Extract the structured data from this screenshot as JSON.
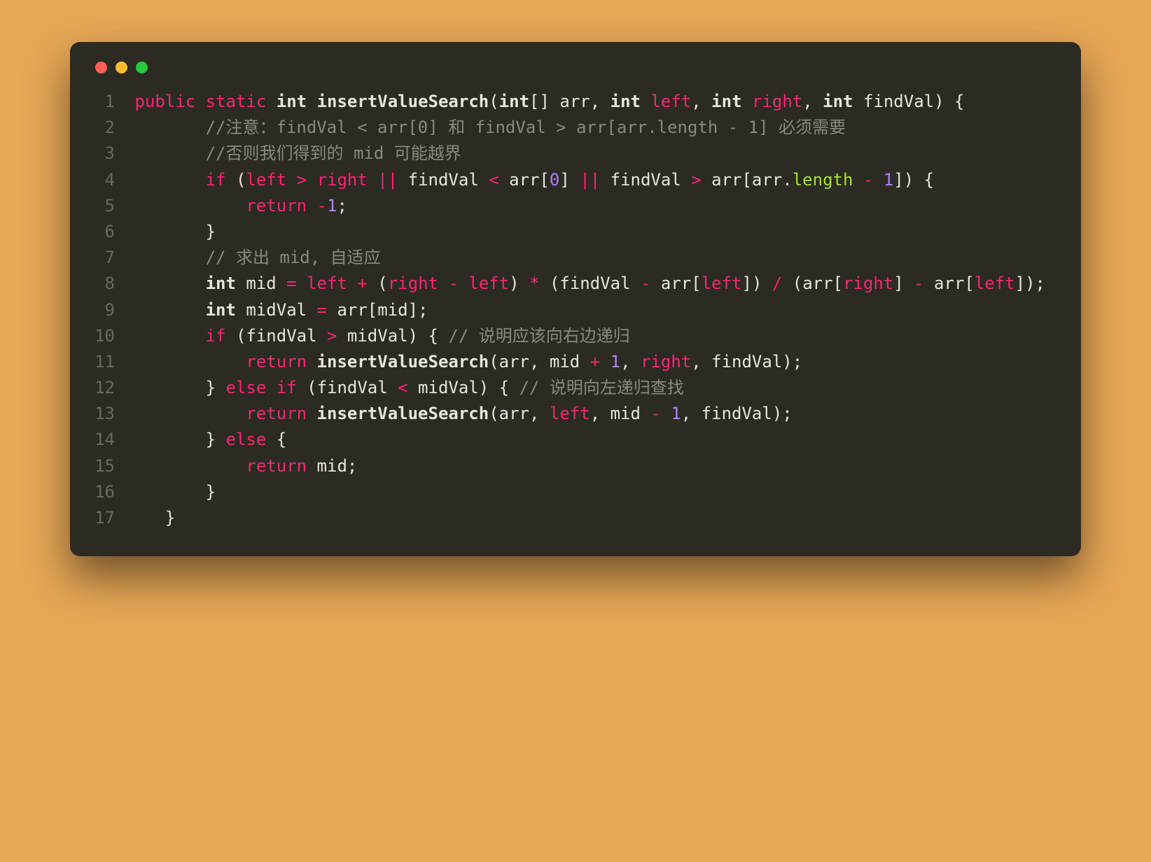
{
  "window": {
    "dots": [
      "red",
      "yellow",
      "green"
    ]
  },
  "code": {
    "lines": [
      {
        "n": "1",
        "tokens": [
          [
            "plain",
            " "
          ],
          [
            "kw",
            "public"
          ],
          [
            "plain",
            " "
          ],
          [
            "kw",
            "static"
          ],
          [
            "plain",
            " "
          ],
          [
            "type",
            "int"
          ],
          [
            "plain",
            " "
          ],
          [
            "fn",
            "insertValueSearch"
          ],
          [
            "pun",
            "("
          ],
          [
            "type",
            "int"
          ],
          [
            "pun",
            "[] "
          ],
          [
            "plain",
            "arr"
          ],
          [
            "pun",
            ", "
          ],
          [
            "type",
            "int"
          ],
          [
            "plain",
            " "
          ],
          [
            "var",
            "left"
          ],
          [
            "pun",
            ", "
          ],
          [
            "type",
            "int"
          ],
          [
            "plain",
            " "
          ],
          [
            "var",
            "right"
          ],
          [
            "pun",
            ", "
          ],
          [
            "type",
            "int"
          ],
          [
            "plain",
            " findVal"
          ],
          [
            "pun",
            ") {"
          ]
        ]
      },
      {
        "n": "2",
        "tokens": [
          [
            "plain",
            "        "
          ],
          [
            "com",
            "//注意：findVal < arr[0] 和 findVal > arr[arr.length - 1] 必须需要"
          ]
        ]
      },
      {
        "n": "3",
        "tokens": [
          [
            "plain",
            "        "
          ],
          [
            "com",
            "//否则我们得到的 mid 可能越界"
          ]
        ]
      },
      {
        "n": "4",
        "tokens": [
          [
            "plain",
            "        "
          ],
          [
            "kw",
            "if"
          ],
          [
            "plain",
            " "
          ],
          [
            "pun",
            "("
          ],
          [
            "var",
            "left"
          ],
          [
            "plain",
            " "
          ],
          [
            "op",
            ">"
          ],
          [
            "plain",
            " "
          ],
          [
            "var",
            "right"
          ],
          [
            "plain",
            " "
          ],
          [
            "op",
            "||"
          ],
          [
            "plain",
            " findVal "
          ],
          [
            "op",
            "<"
          ],
          [
            "plain",
            " arr["
          ],
          [
            "num",
            "0"
          ],
          [
            "plain",
            "] "
          ],
          [
            "op",
            "||"
          ],
          [
            "plain",
            " findVal "
          ],
          [
            "op",
            ">"
          ],
          [
            "plain",
            " arr[arr"
          ],
          [
            "pun",
            "."
          ],
          [
            "prop",
            "length"
          ],
          [
            "plain",
            " "
          ],
          [
            "op",
            "-"
          ],
          [
            "plain",
            " "
          ],
          [
            "num",
            "1"
          ],
          [
            "plain",
            "]"
          ],
          [
            "pun",
            ") {"
          ]
        ]
      },
      {
        "n": "5",
        "tokens": [
          [
            "plain",
            "            "
          ],
          [
            "kw",
            "return"
          ],
          [
            "plain",
            " "
          ],
          [
            "op",
            "-"
          ],
          [
            "num",
            "1"
          ],
          [
            "pun",
            ";"
          ]
        ]
      },
      {
        "n": "6",
        "tokens": [
          [
            "plain",
            "        "
          ],
          [
            "pun",
            "}"
          ]
        ]
      },
      {
        "n": "7",
        "tokens": [
          [
            "plain",
            "        "
          ],
          [
            "com",
            "// 求出 mid, 自适应"
          ]
        ]
      },
      {
        "n": "8",
        "tokens": [
          [
            "plain",
            "        "
          ],
          [
            "type",
            "int"
          ],
          [
            "plain",
            " mid "
          ],
          [
            "op",
            "="
          ],
          [
            "plain",
            " "
          ],
          [
            "var",
            "left"
          ],
          [
            "plain",
            " "
          ],
          [
            "op",
            "+"
          ],
          [
            "plain",
            " "
          ],
          [
            "pun",
            "("
          ],
          [
            "var",
            "right"
          ],
          [
            "plain",
            " "
          ],
          [
            "op",
            "-"
          ],
          [
            "plain",
            " "
          ],
          [
            "var",
            "left"
          ],
          [
            "pun",
            ")"
          ],
          [
            "plain",
            " "
          ],
          [
            "op",
            "*"
          ],
          [
            "plain",
            " "
          ],
          [
            "pun",
            "("
          ],
          [
            "plain",
            "findVal "
          ],
          [
            "op",
            "-"
          ],
          [
            "plain",
            " arr["
          ],
          [
            "var",
            "left"
          ],
          [
            "plain",
            "]"
          ],
          [
            "pun",
            ")"
          ],
          [
            "plain",
            " "
          ],
          [
            "op",
            "/"
          ],
          [
            "plain",
            " "
          ],
          [
            "pun",
            "("
          ],
          [
            "plain",
            "arr["
          ],
          [
            "var",
            "right"
          ],
          [
            "plain",
            "] "
          ],
          [
            "op",
            "-"
          ],
          [
            "plain",
            " arr["
          ],
          [
            "var",
            "left"
          ],
          [
            "plain",
            "]"
          ],
          [
            "pun",
            ");"
          ]
        ]
      },
      {
        "n": "9",
        "tokens": [
          [
            "plain",
            "        "
          ],
          [
            "type",
            "int"
          ],
          [
            "plain",
            " midVal "
          ],
          [
            "op",
            "="
          ],
          [
            "plain",
            " arr[mid]"
          ],
          [
            "pun",
            ";"
          ]
        ]
      },
      {
        "n": "10",
        "tokens": [
          [
            "plain",
            "        "
          ],
          [
            "kw",
            "if"
          ],
          [
            "plain",
            " "
          ],
          [
            "pun",
            "("
          ],
          [
            "plain",
            "findVal "
          ],
          [
            "op",
            ">"
          ],
          [
            "plain",
            " midVal"
          ],
          [
            "pun",
            ") { "
          ],
          [
            "com",
            "// 说明应该向右边递归"
          ]
        ]
      },
      {
        "n": "11",
        "tokens": [
          [
            "plain",
            "            "
          ],
          [
            "kw",
            "return"
          ],
          [
            "plain",
            " "
          ],
          [
            "fn",
            "insertValueSearch"
          ],
          [
            "pun",
            "("
          ],
          [
            "plain",
            "arr"
          ],
          [
            "pun",
            ", "
          ],
          [
            "plain",
            "mid "
          ],
          [
            "op",
            "+"
          ],
          [
            "plain",
            " "
          ],
          [
            "num",
            "1"
          ],
          [
            "pun",
            ", "
          ],
          [
            "var",
            "right"
          ],
          [
            "pun",
            ", "
          ],
          [
            "plain",
            "findVal"
          ],
          [
            "pun",
            ");"
          ]
        ]
      },
      {
        "n": "12",
        "tokens": [
          [
            "plain",
            "        "
          ],
          [
            "pun",
            "} "
          ],
          [
            "kw",
            "else"
          ],
          [
            "plain",
            " "
          ],
          [
            "kw",
            "if"
          ],
          [
            "plain",
            " "
          ],
          [
            "pun",
            "("
          ],
          [
            "plain",
            "findVal "
          ],
          [
            "op",
            "<"
          ],
          [
            "plain",
            " midVal"
          ],
          [
            "pun",
            ") { "
          ],
          [
            "com",
            "// 说明向左递归查找"
          ]
        ]
      },
      {
        "n": "13",
        "tokens": [
          [
            "plain",
            "            "
          ],
          [
            "kw",
            "return"
          ],
          [
            "plain",
            " "
          ],
          [
            "fn",
            "insertValueSearch"
          ],
          [
            "pun",
            "("
          ],
          [
            "plain",
            "arr"
          ],
          [
            "pun",
            ", "
          ],
          [
            "var",
            "left"
          ],
          [
            "pun",
            ", "
          ],
          [
            "plain",
            "mid "
          ],
          [
            "op",
            "-"
          ],
          [
            "plain",
            " "
          ],
          [
            "num",
            "1"
          ],
          [
            "pun",
            ", "
          ],
          [
            "plain",
            "findVal"
          ],
          [
            "pun",
            ");"
          ]
        ]
      },
      {
        "n": "14",
        "tokens": [
          [
            "plain",
            "        "
          ],
          [
            "pun",
            "} "
          ],
          [
            "kw",
            "else"
          ],
          [
            "plain",
            " "
          ],
          [
            "pun",
            "{"
          ]
        ]
      },
      {
        "n": "15",
        "tokens": [
          [
            "plain",
            "            "
          ],
          [
            "kw",
            "return"
          ],
          [
            "plain",
            " mid"
          ],
          [
            "pun",
            ";"
          ]
        ]
      },
      {
        "n": "16",
        "tokens": [
          [
            "plain",
            "        "
          ],
          [
            "pun",
            "}"
          ]
        ]
      },
      {
        "n": "17",
        "tokens": [
          [
            "plain",
            "    "
          ],
          [
            "pun",
            "}"
          ]
        ]
      }
    ]
  }
}
